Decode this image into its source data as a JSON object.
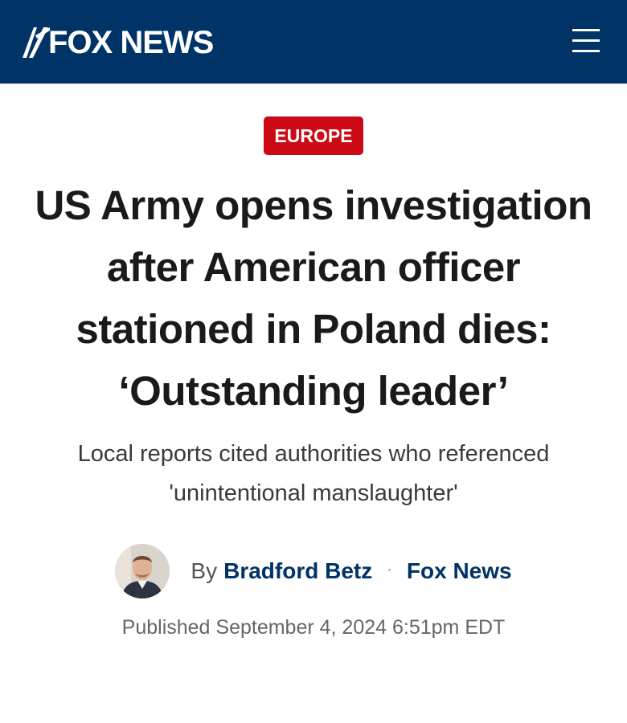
{
  "header": {
    "logo_text": "FOX NEWS",
    "menu_icon": "hamburger-menu-icon",
    "background_color": "#003366"
  },
  "article": {
    "category": "EUROPE",
    "category_color": "#cc0a15",
    "headline": "US Army opens investigation after American officer stationed in Poland dies: ‘Outstanding leader’",
    "subheadline": "Local reports cited authorities who referenced 'unintentional manslaughter'",
    "byline": {
      "prefix": "By",
      "author": "Bradford Betz",
      "separator": "·",
      "source": "Fox News"
    },
    "published": "Published September 4, 2024 6:51pm EDT"
  }
}
